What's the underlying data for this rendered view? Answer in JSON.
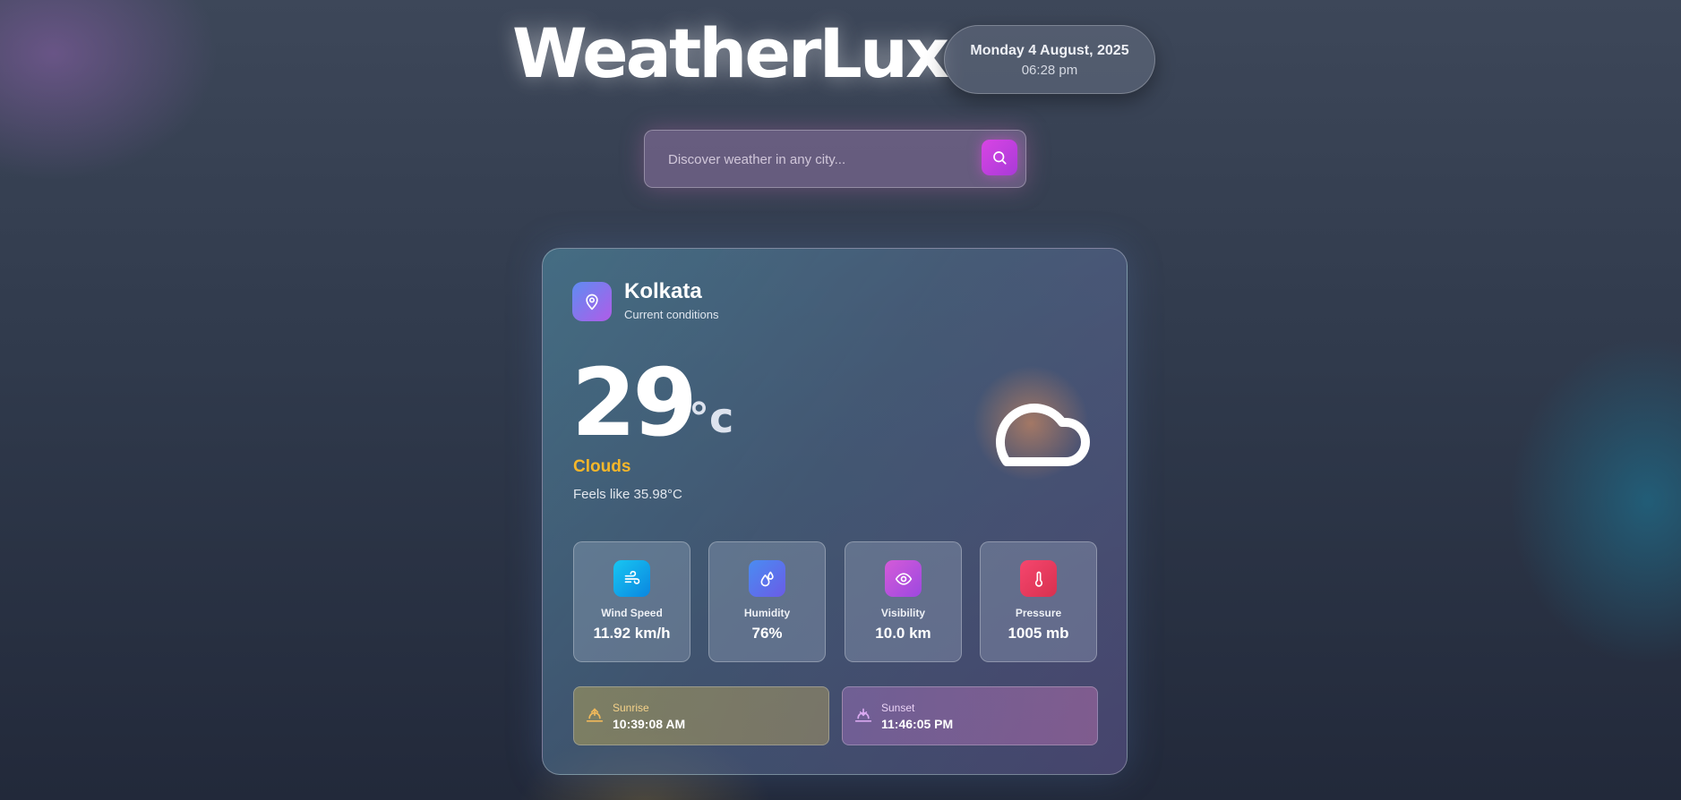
{
  "header": {
    "brand": "WeatherLux",
    "date": "Monday 4 August, 2025",
    "time": "06:28 pm"
  },
  "search": {
    "placeholder": "Discover weather in any city...",
    "value": "",
    "button_icon": "search-icon"
  },
  "current": {
    "city": "Kolkata",
    "subtitle": "Current conditions",
    "temperature": "29",
    "unit": "°c",
    "condition": "Clouds",
    "feels_like": "Feels like 35.98°C",
    "condition_icon": "cloud-icon"
  },
  "stats": [
    {
      "label": "Wind Speed",
      "value": "11.92 km/h",
      "icon": "wind-icon",
      "color": "#12a8e8"
    },
    {
      "label": "Humidity",
      "value": "76%",
      "icon": "droplets-icon",
      "color": "#4e7cf0"
    },
    {
      "label": "Visibility",
      "value": "10.0 km",
      "icon": "eye-icon",
      "color": "#c44fd8"
    },
    {
      "label": "Pressure",
      "value": "1005 mb",
      "icon": "thermometer-icon",
      "color": "#ee3a62"
    }
  ],
  "sun": {
    "sunrise_label": "Sunrise",
    "sunrise": "10:39:08 AM",
    "sunset_label": "Sunset",
    "sunset": "11:46:05 PM"
  },
  "colors": {
    "accent": "#f5b72a",
    "search_button": "#d845e4"
  }
}
